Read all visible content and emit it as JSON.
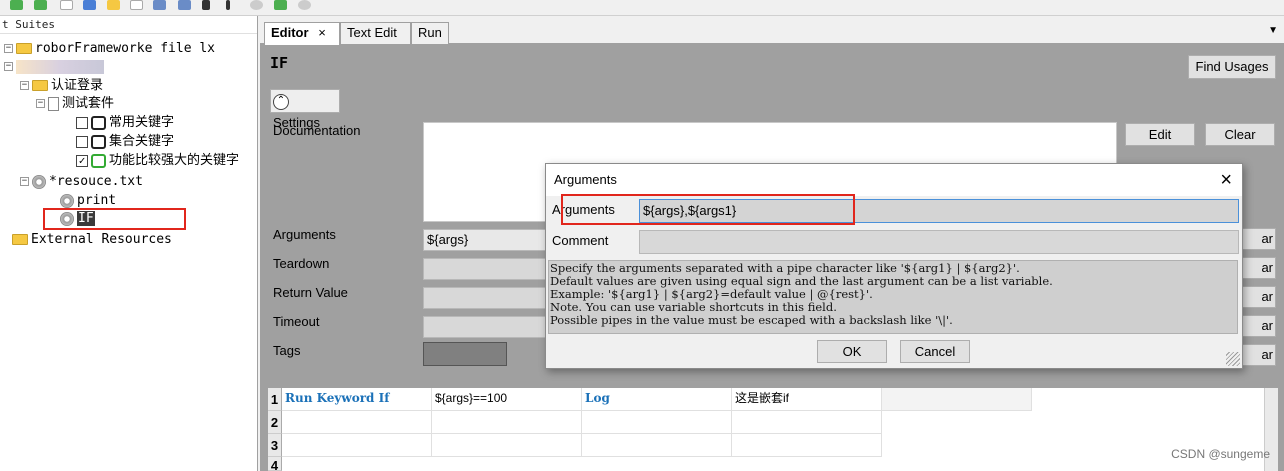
{
  "left_panel": {
    "header": "t Suites",
    "tree": [
      {
        "label": "roborFrameworke file lx"
      },
      {
        "label": ""
      },
      {
        "label": "认证登录"
      },
      {
        "label": "测试套件"
      },
      {
        "label": "常用关键字",
        "checked": false
      },
      {
        "label": "集合关键字",
        "checked": false
      },
      {
        "label": "功能比较强大的关键字",
        "checked": true
      },
      {
        "label": "*resouce.txt"
      },
      {
        "label": "print"
      },
      {
        "label": "IF"
      },
      {
        "label": "External Resources"
      }
    ],
    "check_mark": "✓"
  },
  "tabs": [
    {
      "label": "Editor"
    },
    {
      "label": "Text Edit"
    },
    {
      "label": "Run"
    }
  ],
  "tab_close": "×",
  "editor": {
    "name": "IF",
    "find_usages": "Find Usages",
    "settings_label": "Settings",
    "documentation_label": "Documentation",
    "edit_button": "Edit",
    "clear_button": "Clear",
    "arguments_label": "Arguments",
    "arguments_value": "${args}",
    "teardown_label": "Teardown",
    "return_label": "Return Value",
    "timeout_label": "Timeout",
    "tags_label": "Tags",
    "clear_partial": "ar"
  },
  "grid": {
    "rows": [
      {
        "num": "1",
        "cells": [
          "Run Keyword If",
          "${args}==100",
          "Log",
          "这是嵌套if"
        ]
      },
      {
        "num": "2",
        "cells": [
          "",
          "",
          "",
          ""
        ]
      },
      {
        "num": "3",
        "cells": [
          "",
          "",
          "",
          ""
        ]
      },
      {
        "num": "4",
        "cells": [
          "",
          "",
          "",
          ""
        ]
      }
    ]
  },
  "dialog": {
    "title": "Arguments",
    "close": "×",
    "arguments_label": "Arguments",
    "arguments_value": "${args},${args1}",
    "comment_label": "Comment",
    "comment_value": "",
    "help_lines": [
      "Specify the arguments separated with a pipe character like '${arg1} | ${arg2}'.",
      "Default values are given using equal sign and the last argument can be a list variable.",
      "Example: '${arg1} | ${arg2}=default value | @{rest}'.",
      "Note. You can use variable shortcuts in this field.",
      "Possible pipes in the value must be escaped with a backslash like '\\|'."
    ],
    "ok": "OK",
    "cancel": "Cancel"
  },
  "watermark": "CSDN @sungeme",
  "colors": {
    "highlight": "#e1261c",
    "keyword": "#1b71b8"
  }
}
